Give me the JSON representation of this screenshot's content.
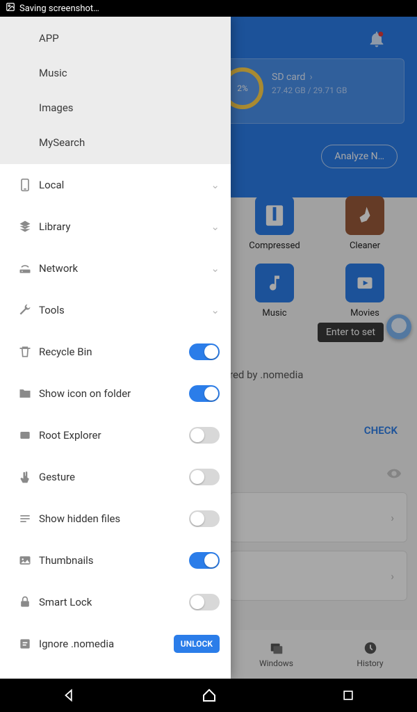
{
  "status": {
    "text": "Saving screenshot…"
  },
  "header": {
    "sd_label": "SD card",
    "sd_used": "27.42 GB / 29.71 GB",
    "ring_percent": "2%",
    "analyze_button": "Analyze N…"
  },
  "tiles": {
    "compressed": "Compressed",
    "cleaner": "Cleaner",
    "music": "Music",
    "movies": "Movies"
  },
  "toast": "Enter to set",
  "nomedia_text": "red by .nomedia",
  "check_label": "CHECK",
  "bottomnav": {
    "windows": "Windows",
    "history": "History"
  },
  "drawer": {
    "quick": {
      "app": "APP",
      "music": "Music",
      "images": "Images",
      "mysearch": "MySearch"
    },
    "groups": {
      "local": "Local",
      "library": "Library",
      "network": "Network",
      "tools": "Tools"
    },
    "settings": {
      "recycle": {
        "label": "Recycle Bin",
        "on": true
      },
      "showicon": {
        "label": "Show icon on folder",
        "on": true
      },
      "root": {
        "label": "Root Explorer",
        "on": false
      },
      "gesture": {
        "label": "Gesture",
        "on": false
      },
      "hidden": {
        "label": "Show hidden files",
        "on": false
      },
      "thumbs": {
        "label": "Thumbnails",
        "on": true
      },
      "smartlock": {
        "label": "Smart Lock",
        "on": false
      },
      "ignoremedia": {
        "label": "Ignore .nomedia",
        "unlock": "UNLOCK"
      }
    }
  }
}
